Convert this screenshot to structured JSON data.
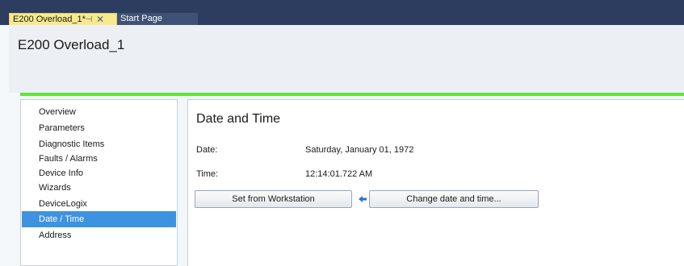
{
  "tabs": [
    {
      "label": "E200 Overload_1*",
      "active": true,
      "pin_glyph": "⊣",
      "close_glyph": "✕"
    },
    {
      "label": "Start Page",
      "active": false
    }
  ],
  "device": {
    "title": "E200 Overload_1"
  },
  "nav": {
    "items": [
      {
        "label": "Overview"
      },
      {
        "label": "Parameters"
      },
      {
        "label": "Diagnostic Items"
      },
      {
        "label": "Faults / Alarms"
      },
      {
        "label": "Device Info"
      },
      {
        "label": "Wizards"
      },
      {
        "label": "DeviceLogix"
      },
      {
        "label": "Date / Time",
        "selected": true
      },
      {
        "label": "Address"
      }
    ]
  },
  "main": {
    "title": "Date and Time",
    "date_label": "Date:",
    "date_value": "Saturday, January 01, 1972",
    "time_label": "Time:",
    "time_value": "12:14:01.722 AM",
    "set_button": "Set from Workstation",
    "change_button": "Change date and time...",
    "arrow_icon": "arrow-left-icon"
  },
  "colors": {
    "tabstrip": "#2c3d60",
    "active_tab": "#f7e98e",
    "accent_bar": "#62e33c",
    "selection": "#3e93e0",
    "arrow": "#2f6fd0"
  }
}
